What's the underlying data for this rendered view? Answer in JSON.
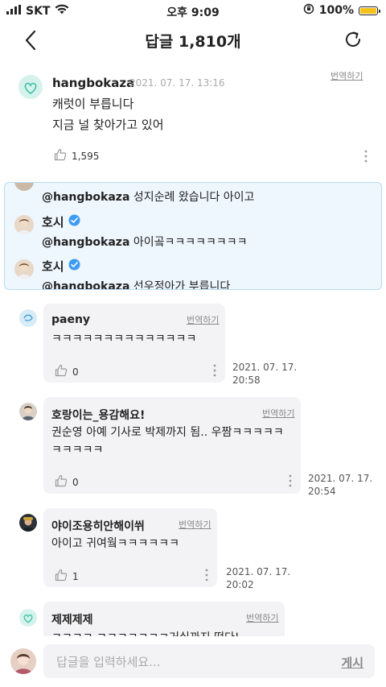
{
  "status_bar": {
    "carrier": "SKT",
    "time": "오후 9:09",
    "battery": "100%",
    "battery_level": 1.0
  },
  "header": {
    "title": "답글 1,810개"
  },
  "post": {
    "author": "hangbokaza",
    "date": "2021. 07. 17. 13:16",
    "translate": "번역하기",
    "lines": [
      "캐럿이 부릅니다",
      "지금 널 찾아가고 있어"
    ],
    "likes": "1,595"
  },
  "mentions": [
    {
      "author": "",
      "mention": "@hangbokaza",
      "text": " 성지순례 왔습니다 아이고"
    },
    {
      "author": "호시",
      "mention": "@hangbokaza",
      "text": " 아이곸ㅋㅋㅋㅋㅋㅋㅋㅋ"
    },
    {
      "author": "호시",
      "mention": "@hangbokaza",
      "text": " 선우정아가 부릅니다"
    }
  ],
  "replies": [
    {
      "author": "paeny",
      "translate": "번역하기",
      "text": "ㅋㅋㅋㅋㅋㅋㅋㅋㅋㅋㅋㅋㅋㅋ",
      "likes": "0",
      "date_line1": "2021. 07. 17.",
      "date_line2": "20:58"
    },
    {
      "author": "호랑이는_용감해요!",
      "translate": "번역하기",
      "text": "권순영 아예 기사로 박제까지 됨.. 우짬ㅋㅋㅋㅋㅋ",
      "text2": "ㅋㅋㅋㅋㅋ",
      "likes": "0",
      "date_line1": "2021. 07. 17.",
      "date_line2": "20:54"
    },
    {
      "author": "야이조용히안해이쒸",
      "translate": "번역하기",
      "text": "아이고 귀여웤ㅋㅋㅋㅋㅋㅋ",
      "likes": "1",
      "date_line1": "2021. 07. 17.",
      "date_line2": "20:02"
    },
    {
      "author": "제제제제",
      "translate": "번역하기",
      "text": "ㅋㅋㅋㅋ ㅋㅋㅋㅋㅋㅋㅋ거실까지 떴다!"
    }
  ],
  "input": {
    "placeholder": "답글을 입력하세요...",
    "post_button": "게시"
  },
  "colors": {
    "verified": "#3e9bf2",
    "mention_bg": "#eef6fe",
    "bubble_bg": "#f3f3f5",
    "battery": "#f4c21a"
  }
}
